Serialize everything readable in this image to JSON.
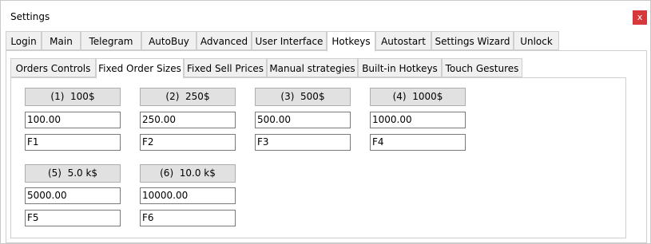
{
  "window": {
    "title": "Settings",
    "close_label": "x"
  },
  "top_tabs": [
    "Login",
    "Main",
    "Telegram",
    "AutoBuy",
    "Advanced",
    "User Interface",
    "Hotkeys",
    "Autostart",
    "Settings Wizard",
    "Unlock"
  ],
  "top_tabs_active": "Hotkeys",
  "sub_tabs": [
    "Orders Controls",
    "Fixed Order Sizes",
    "Fixed Sell Prices",
    "Manual strategies",
    "Built-in Hotkeys",
    "Touch Gestures"
  ],
  "sub_tabs_active": "Fixed Order Sizes",
  "order_sizes": [
    {
      "button": "(1)  100$",
      "amount": "100.00",
      "hotkey": "F1"
    },
    {
      "button": "(2)  250$",
      "amount": "250.00",
      "hotkey": "F2"
    },
    {
      "button": "(3)  500$",
      "amount": "500.00",
      "hotkey": "F3"
    },
    {
      "button": "(4)  1000$",
      "amount": "1000.00",
      "hotkey": "F4"
    },
    {
      "button": "(5)  5.0 k$",
      "amount": "5000.00",
      "hotkey": "F5"
    },
    {
      "button": "(6)  10.0 k$",
      "amount": "10000.00",
      "hotkey": "F6"
    }
  ]
}
